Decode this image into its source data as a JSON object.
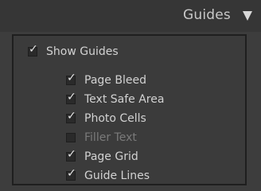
{
  "panel": {
    "title": "Guides",
    "collapse_glyph": "▼"
  },
  "show_guides": {
    "label": "Show Guides",
    "checked": true
  },
  "guides": [
    {
      "label": "Page Bleed",
      "checked": true
    },
    {
      "label": "Text Safe Area",
      "checked": true
    },
    {
      "label": "Photo Cells",
      "checked": true
    },
    {
      "label": "Filler Text",
      "checked": false
    },
    {
      "label": "Page Grid",
      "checked": true
    },
    {
      "label": "Guide Lines",
      "checked": true
    }
  ],
  "icons": {
    "check": "check-icon",
    "collapse": "triangle-down-icon"
  },
  "colors": {
    "panel_bg": "#3d3d3d",
    "header_bg": "#363636",
    "text": "#d2d2d2",
    "text_disabled": "#7a7a7a"
  }
}
